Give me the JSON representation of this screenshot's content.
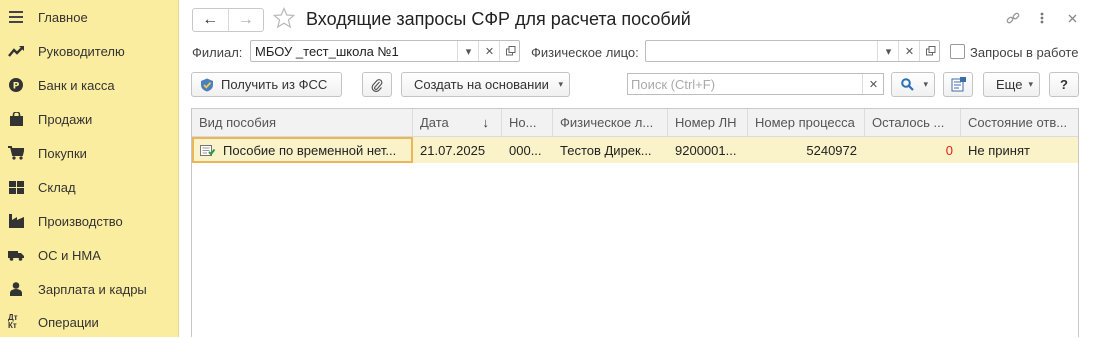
{
  "sidebar": {
    "items": [
      {
        "label": "Главное",
        "icon": "menu-lines-icon"
      },
      {
        "label": "Руководителю",
        "icon": "trend-chart-icon"
      },
      {
        "label": "Банк и касса",
        "icon": "coin-icon"
      },
      {
        "label": "Продажи",
        "icon": "shopping-bag-icon"
      },
      {
        "label": "Покупки",
        "icon": "cart-icon"
      },
      {
        "label": "Склад",
        "icon": "warehouse-grid-icon"
      },
      {
        "label": "Производство",
        "icon": "factory-icon"
      },
      {
        "label": "ОС и НМА",
        "icon": "truck-icon"
      },
      {
        "label": "Зарплата и кадры",
        "icon": "person-icon"
      },
      {
        "label": "Операции",
        "icon": "dt-kt-icon",
        "icon_text": "Дт Кт"
      }
    ]
  },
  "header": {
    "title": "Входящие запросы СФР для расчета пособий",
    "back_icon": "←",
    "forward_icon": "→"
  },
  "filters": {
    "branch_label": "Филиал:",
    "branch_value": "МБОУ _тест_школа №1",
    "person_label": "Физическое лицо:",
    "person_value": "",
    "in_work_label": "Запросы в работе",
    "in_work_checked": false
  },
  "toolbar": {
    "get_from_fss": "Получить из ФСС",
    "create_based_on": "Создать на основании",
    "search_placeholder": "Поиск (Ctrl+F)",
    "more": "Еще",
    "help": "?"
  },
  "table": {
    "columns": [
      "Вид пособия",
      "Дата",
      "Но...",
      "Физическое л...",
      "Номер ЛН",
      "Номер процесса",
      "Осталось ...",
      "Состояние отв..."
    ],
    "sort_indicator": "↓",
    "rows": [
      {
        "benefit_type": "Пособие по временной нет...",
        "date": "21.07.2025",
        "number": "000...",
        "person": "Тестов Дирек...",
        "ln_number": "9200001...",
        "process_number": "5240972",
        "remaining": "0",
        "state": "Не принят"
      }
    ]
  },
  "colors": {
    "sidebar_bg": "#fbeda0",
    "row_selected_bg": "#faf2c8",
    "remaining_zero": "#e02020",
    "focus_border": "#e9b65a"
  }
}
